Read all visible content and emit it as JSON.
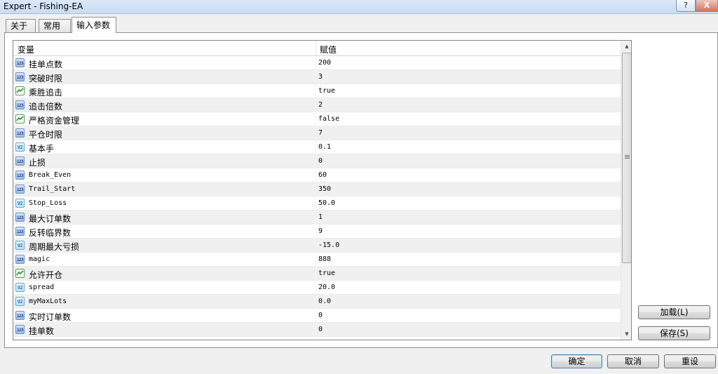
{
  "window": {
    "title": "Expert - Fishing-EA",
    "help_label": "?",
    "close_label": "X"
  },
  "tabs": [
    {
      "label": "关于"
    },
    {
      "label": "常用"
    },
    {
      "label": "输入参数"
    }
  ],
  "grid": {
    "col_variable": "变量",
    "col_value": "赋值",
    "rows": [
      {
        "type": "int",
        "icon": "int-icon",
        "icon_text": "123",
        "name": "挂单点数",
        "value": "200"
      },
      {
        "type": "int",
        "icon": "int-icon",
        "icon_text": "123",
        "name": "突破时限",
        "value": "3"
      },
      {
        "type": "bool",
        "icon": "bool-icon",
        "icon_text": "",
        "name": "乘胜追击",
        "value": "true"
      },
      {
        "type": "int",
        "icon": "int-icon",
        "icon_text": "123",
        "name": "追击倍数",
        "value": "2"
      },
      {
        "type": "bool",
        "icon": "bool-icon",
        "icon_text": "",
        "name": "严格资金管理",
        "value": "false"
      },
      {
        "type": "int",
        "icon": "int-icon",
        "icon_text": "123",
        "name": "平仓时限",
        "value": "7"
      },
      {
        "type": "dbl",
        "icon": "double-icon",
        "icon_text": "V2",
        "name": "基本手",
        "value": "0.1"
      },
      {
        "type": "int",
        "icon": "int-icon",
        "icon_text": "123",
        "name": "止损",
        "value": "0"
      },
      {
        "type": "int",
        "icon": "int-icon",
        "icon_text": "123",
        "name": "Break_Even",
        "value": "60"
      },
      {
        "type": "int",
        "icon": "int-icon",
        "icon_text": "123",
        "name": "Trail_Start",
        "value": "350"
      },
      {
        "type": "dbl",
        "icon": "double-icon",
        "icon_text": "V2",
        "name": "Stop_Loss",
        "value": "50.0"
      },
      {
        "type": "int",
        "icon": "int-icon",
        "icon_text": "123",
        "name": "最大订单数",
        "value": "1"
      },
      {
        "type": "int",
        "icon": "int-icon",
        "icon_text": "123",
        "name": "反转临界数",
        "value": "9"
      },
      {
        "type": "dbl",
        "icon": "double-icon",
        "icon_text": "V2",
        "name": "周期最大亏损",
        "value": "-15.0"
      },
      {
        "type": "int",
        "icon": "int-icon",
        "icon_text": "123",
        "name": "magic",
        "value": "888"
      },
      {
        "type": "bool",
        "icon": "bool-icon",
        "icon_text": "",
        "name": "允许开仓",
        "value": "true"
      },
      {
        "type": "dbl",
        "icon": "double-icon",
        "icon_text": "V2",
        "name": "spread",
        "value": "20.0"
      },
      {
        "type": "dbl",
        "icon": "double-icon",
        "icon_text": "V2",
        "name": "myMaxLots",
        "value": "0.0"
      },
      {
        "type": "int",
        "icon": "int-icon",
        "icon_text": "123",
        "name": "实时订单数",
        "value": "0"
      },
      {
        "type": "int",
        "icon": "int-icon",
        "icon_text": "123",
        "name": "挂单数",
        "value": "0"
      }
    ]
  },
  "side_buttons": {
    "load_label": "加载(L)",
    "save_label": "保存(S)"
  },
  "footer_buttons": {
    "ok_label": "确定",
    "cancel_label": "取消",
    "reset_label": "重设"
  },
  "colors": {
    "titlebar": "#c9dcf1",
    "grid_alt_row": "#f0f0f0",
    "bool_icon_green": "#4aa24a",
    "default_button_border": "#3c7fb1"
  }
}
